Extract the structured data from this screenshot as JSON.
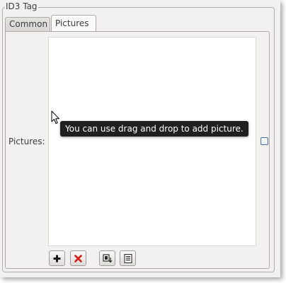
{
  "dialog": {
    "group_title": "ID3 Tag"
  },
  "tabs": [
    {
      "label": "Common",
      "active": false
    },
    {
      "label": "Pictures",
      "active": true
    }
  ],
  "pictures_panel": {
    "field_label": "Pictures:",
    "checkbox_checked": false,
    "toolbar": [
      {
        "icon": "add-icon"
      },
      {
        "icon": "delete-icon"
      },
      {
        "icon": "export-icon"
      },
      {
        "icon": "properties-icon"
      }
    ]
  },
  "tooltip": {
    "text": "You can use drag and drop to add picture."
  },
  "colors": {
    "add_icon": "#1a1a1a",
    "delete_icon": "#d21a12",
    "tooltip_bg": "#202020",
    "checkbox_border": "#4a6fa5"
  }
}
